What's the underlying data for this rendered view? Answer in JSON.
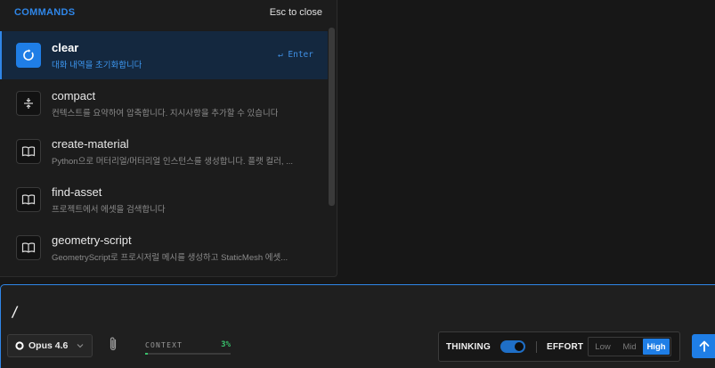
{
  "palette": {
    "title": "COMMANDS",
    "close_hint": "Esc to close",
    "commands": [
      {
        "name": "clear",
        "description": "대화 내역을 초기화합니다",
        "shortcut": "↵ Enter",
        "icon": "refresh-icon",
        "active": true
      },
      {
        "name": "compact",
        "description": "컨텍스트를 요약하여 압축합니다. 지시사항을 추가할 수 있습니다",
        "icon": "compress-icon",
        "active": false
      },
      {
        "name": "create-material",
        "description": "Python으로 머터리얼/머터리얼 인스턴스를 생성합니다. 플랫 컬러, ...",
        "icon": "book-icon",
        "active": false
      },
      {
        "name": "find-asset",
        "description": "프로젝트에서 에셋을 검색합니다",
        "icon": "book-icon",
        "active": false
      },
      {
        "name": "geometry-script",
        "description": "GeometryScript로 프로시저럴 메시를 생성하고 StaticMesh 에셋...",
        "icon": "book-icon",
        "active": false
      }
    ]
  },
  "input": {
    "value": "/",
    "model": "Opus 4.6",
    "context_label": "CONTEXT",
    "context_value": "3%",
    "context_fraction": 0.03,
    "thinking_label": "THINKING",
    "thinking_enabled": true,
    "effort_label": "EFFORT",
    "effort_options": [
      "Low",
      "Mid",
      "High"
    ],
    "effort_selected": "High"
  },
  "colors": {
    "accent": "#1f7ee6",
    "context_ok": "#39c06b",
    "background": "#171717"
  }
}
